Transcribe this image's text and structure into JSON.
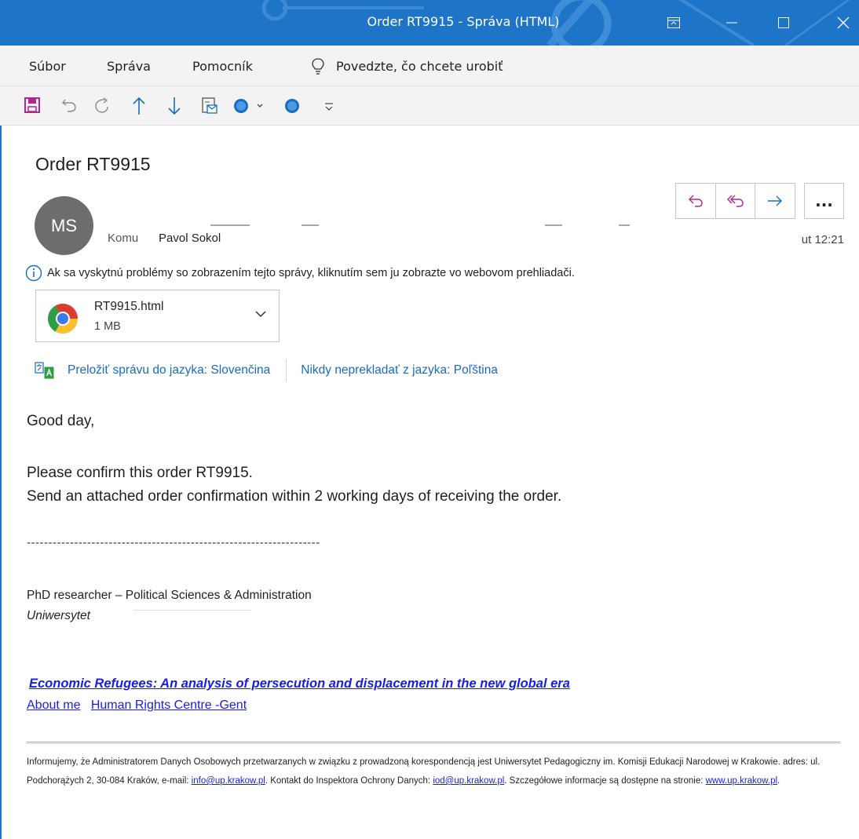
{
  "window": {
    "title": "Order RT9915  -  Správa (HTML)"
  },
  "menu": {
    "items": [
      "Súbor",
      "Správa",
      "Pomocník"
    ],
    "tell_me": "Povedzte, čo chcete urobiť"
  },
  "message": {
    "subject": "Order RT9915",
    "avatar_initials": "MS",
    "to_label": "Komu",
    "to_name": "Pavol Sokol",
    "time": "ut 12:21",
    "info_text": "Ak sa vyskytnú problémy so zobrazením tejto správy, kliknutím sem ju zobrazte vo webovom prehliadači.",
    "attachment": {
      "name": "RT9915.html",
      "size": "1 MB"
    },
    "translate_link": "Preložiť správu do jazyka: Slovenčina",
    "never_translate_link": "Nikdy neprekladať z jazyka: Poľština",
    "more_label": "..."
  },
  "body": {
    "greeting": "Good day,",
    "line1": "Please confirm this order RT9915.",
    "line2": "Send an attached order confirmation within 2 working days of receiving the order.",
    "separator": "--------------------------------------------------------------------",
    "sig_title": "PhD researcher – Political Sciences & Administration",
    "sig_org": "Uniwersytet",
    "book_link": "Economic Refugees: An analysis of persecution and displacement in the new global era",
    "about_link": "About me",
    "hrc_link": "Human Rights Centre -Gent"
  },
  "footer": {
    "text1": "Informujemy, że Administratorem Danych Osobowych przetwarzanych w związku z prowadzoną korespondencją jest Uniwersytet Pedagogiczny im. Komisji Edukacji Narodowej w Krakowie. adres: ul. Podchorążych 2, 30-084 Kraków, e-mail: ",
    "email1": "info@up.krakow.pl",
    "text2": ". Kontakt do Inspektora Ochrony Danych: ",
    "email2": "iod@up.krakow.pl",
    "text3": ". Szczegółowe informacje są dostępne na stronie: ",
    "website": "www.up.krakow.pl",
    "text4": "."
  },
  "colors": {
    "titlebar": "#1e74c6",
    "accent_purple": "#b0278f",
    "link_blue": "#1a6cc0",
    "body_link": "#1a1ee0"
  },
  "icons": {
    "qat": [
      "save-icon",
      "undo-icon",
      "redo-icon",
      "previous-item-icon",
      "next-item-icon",
      "template-icon",
      "circle-dropdown-icon",
      "circle-icon",
      "customize-icon"
    ],
    "title": [
      "ribbon-display-icon",
      "minimize-icon",
      "maximize-icon",
      "close-icon"
    ]
  }
}
